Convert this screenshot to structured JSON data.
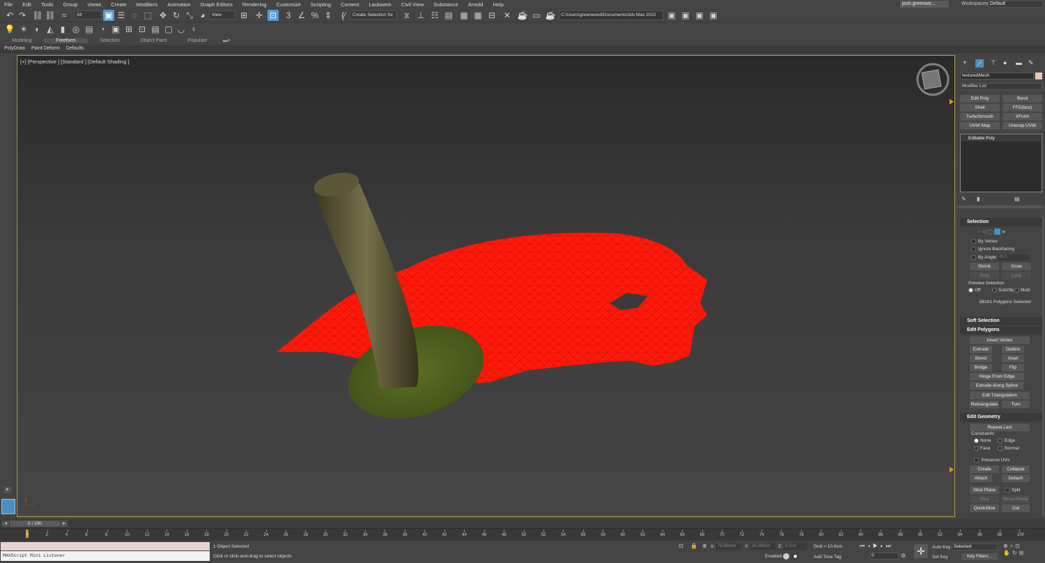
{
  "menu": [
    "File",
    "Edit",
    "Tools",
    "Group",
    "Views",
    "Create",
    "Modifiers",
    "Animation",
    "Graph Editors",
    "Rendering",
    "Customize",
    "Scripting",
    "Content",
    "Laubwerk",
    "Civil View",
    "Substance",
    "Arnold",
    "Help"
  ],
  "user": "josh.greenwo...",
  "workspaces_label": "Workspaces:",
  "workspace": "Default",
  "toolbar": {
    "filter": "All",
    "ref_coord": "View",
    "selection_set": "Create Selection Se",
    "project_path": "C:\\Users\\greenwood\\Documents\\3ds Max 2022"
  },
  "ribbon": {
    "tabs": [
      "Modeling",
      "Freeform",
      "Selection",
      "Object Paint",
      "Populate"
    ],
    "subtabs": [
      "PolyDraw",
      "Paint Deform",
      "Defaults"
    ]
  },
  "viewport": {
    "label": "[+] [Perspective ] [Standard ] [Default Shading ]"
  },
  "command_panel": {
    "object_name": "texturedMesh",
    "object_color": "#e8c8b8",
    "modifier_list": "Modifier List",
    "modifier_buttons": [
      "Edit Poly",
      "Bend",
      "Shell",
      "FFD(box)",
      "TurboSmooth",
      "XForm",
      "UVW Map",
      "Unwrap UVW"
    ],
    "stack_item": "Editable Poly",
    "selection": {
      "title": "Selection",
      "by_vertex": "By Vertex",
      "ignore_backfacing": "Ignore Backfacing",
      "by_angle": "By Angle:",
      "angle_value": "45.0",
      "shrink": "Shrink",
      "grow": "Grow",
      "ring": "Ring",
      "loop": "Loop",
      "preview_selection": "Preview Selection",
      "preview_options": [
        "Off",
        "SubObj",
        "Multi"
      ],
      "status": "88161 Polygons Selected"
    },
    "soft_selection": "Soft Selection",
    "edit_polygons": {
      "title": "Edit Polygons",
      "insert_vertex": "Insert Vertex",
      "extrude": "Extrude",
      "outline": "Outline",
      "bevel": "Bevel",
      "inset": "Inset",
      "bridge": "Bridge",
      "flip": "Flip",
      "hinge": "Hinge From Edge",
      "extrude_spline": "Extrude Along Spline",
      "edit_tri": "Edit Triangulation",
      "retriangulate": "Retriangulate",
      "turn": "Turn"
    },
    "edit_geometry": {
      "title": "Edit Geometry",
      "repeat_last": "Repeat Last",
      "constraints": "Constraints",
      "c_none": "None",
      "c_edge": "Edge",
      "c_face": "Face",
      "c_normal": "Normal",
      "preserve_uvs": "Preserve UVs",
      "create": "Create",
      "collapse": "Collapse",
      "attach": "Attach",
      "detach": "Detach",
      "slice_plane": "Slice Plane",
      "split": "Split",
      "slice": "Slice",
      "reset_plane": "Reset Plane",
      "quickslice": "QuickSlice",
      "cut": "Cut"
    }
  },
  "timeline": {
    "frame": "0 / 100",
    "ticks": [
      "0",
      "2",
      "4",
      "6",
      "8",
      "10",
      "12",
      "14",
      "16",
      "18",
      "20",
      "22",
      "24",
      "26",
      "28",
      "30",
      "32",
      "34",
      "36",
      "38",
      "40",
      "42",
      "44",
      "46",
      "48",
      "50",
      "52",
      "54",
      "56",
      "58",
      "60",
      "62",
      "64",
      "66",
      "68",
      "70",
      "72",
      "74",
      "76",
      "78",
      "80",
      "82",
      "84",
      "86",
      "88",
      "90",
      "92",
      "94",
      "96",
      "98",
      "100"
    ]
  },
  "status": {
    "listener": "MAXScript Mini Listener",
    "selected": "1 Object Selected",
    "prompt": "Click or click-and-drag to select objects",
    "x_label": "X:",
    "x_value": "75.684cm",
    "y_label": "Y:",
    "y_value": "36.489cm",
    "z_label": "Z:",
    "z_value": "0.0cm",
    "grid": "Grid = 10.0cm",
    "enabled": "Enabled:",
    "add_time_tag": "Add Time Tag",
    "auto_key": "Auto Key",
    "set_key": "Set Key",
    "key_mode": "Selected",
    "key_filters": "Key Filters...",
    "current_frame": "0"
  }
}
